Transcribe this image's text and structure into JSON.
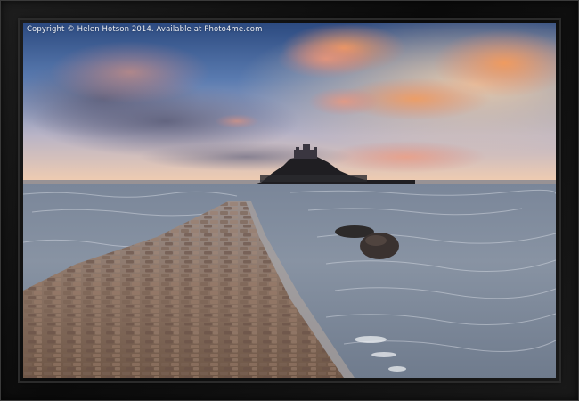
{
  "photo": {
    "watermark": "Copyright © Helen Hotson 2014. Available at Photo4me.com",
    "subject": "tidal causeway to island castle at sunset"
  },
  "colors": {
    "frame": "#111111",
    "sky_top": "#2f4f86",
    "sky_horizon": "#f3c9a6",
    "cloud_pink": "#e58a7a",
    "sea": "#8a97a6",
    "causeway": "#8a6d5e"
  }
}
